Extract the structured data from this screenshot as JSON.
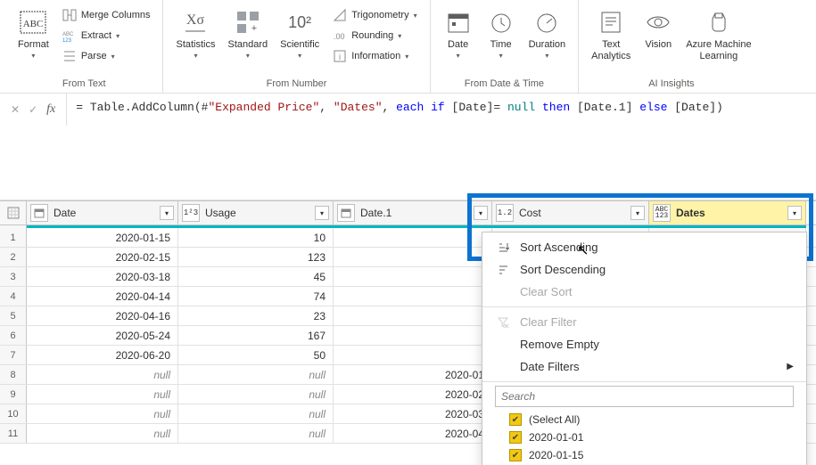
{
  "ribbon": {
    "format": {
      "label": "Format"
    },
    "merge": "Merge Columns",
    "extract": "Extract",
    "parse": "Parse",
    "stats": "Statistics",
    "standard": "Standard",
    "scientific": "Scientific",
    "ten": "10²",
    "trig": "Trigonometry",
    "rounding": "Rounding",
    "info": "Information",
    "date": "Date",
    "time": "Time",
    "duration": "Duration",
    "text": "Text\nAnalytics",
    "vision": "Vision",
    "azml": "Azure Machine\nLearning",
    "g1": "From Text",
    "g2": "From Number",
    "g3": "From Date & Time",
    "g4": "AI Insights"
  },
  "formula": {
    "pre": "= Table.AddColumn(#",
    "s1": "\"Expanded Price\"",
    "c1": ", ",
    "s2": "\"Dates\"",
    "c2": ", ",
    "kw1": "each if",
    "c3": " [Date]= ",
    "nul": "null",
    "c4": " ",
    "kw2": "then",
    "c5": " [Date.1] ",
    "kw3": "else",
    "c6": " [Date])"
  },
  "cols": {
    "date": "Date",
    "usage": "Usage",
    "date1": "Date.1",
    "cost": "Cost",
    "dates": "Dates",
    "typ_num": "1²3",
    "typ_dec": "1.2",
    "typ_abc": "ABC\n123"
  },
  "rows": [
    {
      "n": "1",
      "date": "2020-01-15",
      "usage": "10",
      "date1": ""
    },
    {
      "n": "2",
      "date": "2020-02-15",
      "usage": "123",
      "date1": ""
    },
    {
      "n": "3",
      "date": "2020-03-18",
      "usage": "45",
      "date1": ""
    },
    {
      "n": "4",
      "date": "2020-04-14",
      "usage": "74",
      "date1": ""
    },
    {
      "n": "5",
      "date": "2020-04-16",
      "usage": "23",
      "date1": ""
    },
    {
      "n": "6",
      "date": "2020-05-24",
      "usage": "167",
      "date1": ""
    },
    {
      "n": "7",
      "date": "2020-06-20",
      "usage": "50",
      "date1": ""
    },
    {
      "n": "8",
      "date": "null",
      "usage": "null",
      "date1": "2020-01"
    },
    {
      "n": "9",
      "date": "null",
      "usage": "null",
      "date1": "2020-02"
    },
    {
      "n": "10",
      "date": "null",
      "usage": "null",
      "date1": "2020-03"
    },
    {
      "n": "11",
      "date": "null",
      "usage": "null",
      "date1": "2020-04"
    }
  ],
  "menu": {
    "sortAsc": "Sort Ascending",
    "sortDesc": "Sort Descending",
    "clearSort": "Clear Sort",
    "clearFilter": "Clear Filter",
    "removeEmpty": "Remove Empty",
    "dateFilters": "Date Filters",
    "search": "Search",
    "selectAll": "(Select All)",
    "v1": "2020-01-01",
    "v2": "2020-01-15"
  }
}
